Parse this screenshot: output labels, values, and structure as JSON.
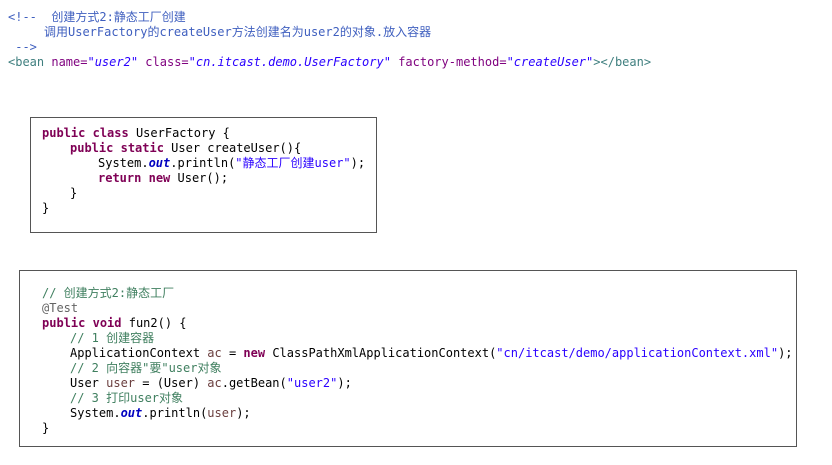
{
  "xml_snippet": {
    "comment_open": "<!-- ",
    "comment_title": "创建方式2:静态工厂创建",
    "comment_desc": "调用UserFactory的createUser方法创建名为user2的对象.放入容器",
    "comment_close": " -->",
    "bean_tag_open": "<bean ",
    "attr_name": "name=",
    "attr_name_value": "\"user2\"",
    "attr_class": "class=",
    "attr_class_value": "\"cn.itcast.demo.UserFactory\"",
    "attr_method": "factory-method=",
    "attr_method_value": "\"createUser\"",
    "bean_tag_close": "></bean>"
  },
  "factory_class": {
    "kw_public": "public",
    "kw_class": "class",
    "class_decl": " UserFactory {",
    "kw_public2": "public",
    "kw_static": "static",
    "method_decl": " User createUser(){",
    "sys": "System.",
    "out": "out",
    "println": ".println(",
    "message": "\"静态工厂创建user\"",
    "println_end": ");",
    "kw_return": "return",
    "kw_new": "new",
    "return_rest": " User();",
    "close_method": "}",
    "close_class": "}"
  },
  "test_method": {
    "comment1": "// 创建方式2:静态工厂",
    "annotation": "@Test",
    "kw_public": "public",
    "kw_void": "void",
    "method_decl": " fun2() {",
    "comment2": "// 1 创建容器",
    "ctx_type": "ApplicationContext ",
    "ctx_var": "ac",
    "ctx_eq": " = ",
    "kw_new": "new",
    "ctx_ctor": " ClassPathXmlApplicationContext(",
    "ctx_path": "\"cn/itcast/demo/applicationContext.xml\"",
    "ctx_end": ");",
    "comment3": "// 2 向容器\"要\"user对象",
    "user_type": "User ",
    "user_var": "user",
    "user_cast": " = (User) ",
    "user_ac": "ac",
    "getbean": ".getBean(",
    "getbean_arg": "\"user2\"",
    "getbean_end": ");",
    "comment4": "// 3 打印user对象",
    "sys": "System.",
    "out": "out",
    "println": ".println(",
    "print_arg": "user",
    "print_end": ");",
    "close": "}"
  }
}
